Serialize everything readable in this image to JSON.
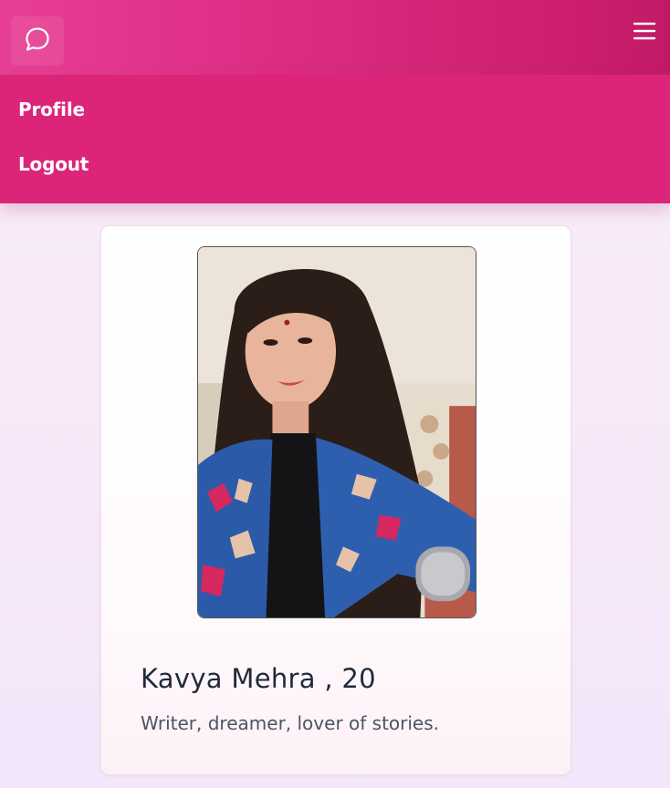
{
  "header": {
    "chat_icon": "chat-bubble-icon",
    "menu_icon": "hamburger-menu-icon"
  },
  "nav": {
    "items": [
      {
        "label": "Profile"
      },
      {
        "label": "Logout"
      }
    ]
  },
  "profile": {
    "name_line": "Kavya Mehra , 20",
    "bio": "Writer, dreamer, lover of stories."
  },
  "colors": {
    "header_start": "#e73f95",
    "header_end": "#c01a66",
    "dropdown": "#dc2578",
    "page_background": "#f7e9f8",
    "name_text": "#1f2a3a",
    "bio_text": "#4a5563"
  }
}
